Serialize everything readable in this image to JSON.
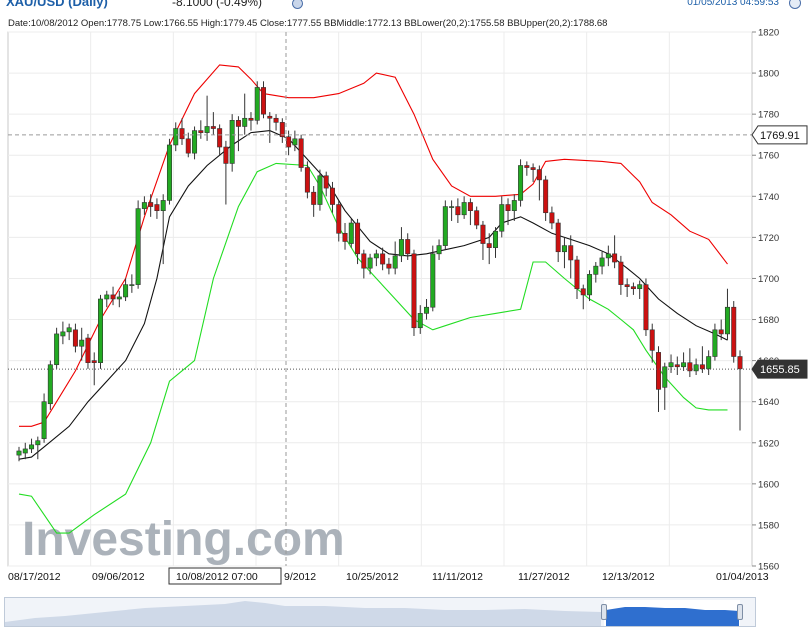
{
  "header": {
    "symbol": "XAU/USD (Daily)",
    "change": "-8.1000 (-0.49%)",
    "timestamp": "01/05/2013 04:59:53"
  },
  "info_bar": "Date:10/08/2012 Open:1778.75 Low:1766.55 High:1779.45 Close:1777.55 BBMiddle:1772.13 BBLower(20,2):1755.58 BBUpper(20,2):1788.68",
  "watermark": "Investing.com",
  "crosshair": {
    "date_label": "10/08/2012 07:00",
    "price_label": "1769.91"
  },
  "last_price_label": "1655.85",
  "colors": {
    "up": "#22aa22",
    "down": "#cc1111",
    "bb_upper": "#ee0000",
    "bb_lower": "#22dd22",
    "bb_middle": "#111111"
  },
  "chart_data": {
    "type": "candlestick",
    "xlabels": [
      "08/17/2012",
      "09/06/2012",
      "10/08/2012 07:00",
      "9/2012",
      "10/25/2012",
      "11/11/2012",
      "11/27/2012",
      "12/13/2012",
      "01/04/2013"
    ],
    "ylim": [
      1560,
      1820
    ],
    "yticks": [
      1560,
      1580,
      1600,
      1620,
      1640,
      1660,
      1680,
      1700,
      1720,
      1740,
      1760,
      1780,
      1800,
      1820
    ],
    "candles": [
      {
        "open": 1614,
        "close": 1616,
        "high": 1618,
        "low": 1611
      },
      {
        "open": 1615,
        "close": 1617,
        "high": 1620,
        "low": 1612
      },
      {
        "open": 1617,
        "close": 1619,
        "high": 1622,
        "low": 1615
      },
      {
        "open": 1619,
        "close": 1621,
        "high": 1623,
        "low": 1612
      },
      {
        "open": 1622,
        "close": 1640,
        "high": 1644,
        "low": 1620
      },
      {
        "open": 1639,
        "close": 1658,
        "high": 1660,
        "low": 1636
      },
      {
        "open": 1658,
        "close": 1673,
        "high": 1676,
        "low": 1656
      },
      {
        "open": 1672,
        "close": 1674,
        "high": 1679,
        "low": 1668
      },
      {
        "open": 1674,
        "close": 1676,
        "high": 1678,
        "low": 1670
      },
      {
        "open": 1675,
        "close": 1667,
        "high": 1678,
        "low": 1664
      },
      {
        "open": 1667,
        "close": 1670,
        "high": 1676,
        "low": 1660
      },
      {
        "open": 1671,
        "close": 1659,
        "high": 1673,
        "low": 1656
      },
      {
        "open": 1660,
        "close": 1659,
        "high": 1664,
        "low": 1648
      },
      {
        "open": 1659,
        "close": 1690,
        "high": 1692,
        "low": 1656
      },
      {
        "open": 1690,
        "close": 1692,
        "high": 1694,
        "low": 1686
      },
      {
        "open": 1692,
        "close": 1690,
        "high": 1696,
        "low": 1687
      },
      {
        "open": 1690,
        "close": 1691,
        "high": 1694,
        "low": 1686
      },
      {
        "open": 1691,
        "close": 1697,
        "high": 1700,
        "low": 1689
      },
      {
        "open": 1697,
        "close": 1697,
        "high": 1702,
        "low": 1693
      },
      {
        "open": 1697,
        "close": 1734,
        "high": 1738,
        "low": 1695
      },
      {
        "open": 1734,
        "close": 1737,
        "high": 1740,
        "low": 1731
      },
      {
        "open": 1737,
        "close": 1735,
        "high": 1741,
        "low": 1730
      },
      {
        "open": 1736,
        "close": 1733,
        "high": 1739,
        "low": 1729
      },
      {
        "open": 1733,
        "close": 1738,
        "high": 1741,
        "low": 1707
      },
      {
        "open": 1738,
        "close": 1765,
        "high": 1768,
        "low": 1736
      },
      {
        "open": 1765,
        "close": 1773,
        "high": 1776,
        "low": 1762
      },
      {
        "open": 1773,
        "close": 1768,
        "high": 1778,
        "low": 1765
      },
      {
        "open": 1768,
        "close": 1761,
        "high": 1771,
        "low": 1759
      },
      {
        "open": 1761,
        "close": 1772,
        "high": 1774,
        "low": 1758
      },
      {
        "open": 1772,
        "close": 1771,
        "high": 1777,
        "low": 1768
      },
      {
        "open": 1771,
        "close": 1774,
        "high": 1789,
        "low": 1767
      },
      {
        "open": 1774,
        "close": 1773,
        "high": 1781,
        "low": 1770
      },
      {
        "open": 1773,
        "close": 1764,
        "high": 1775,
        "low": 1760
      },
      {
        "open": 1764,
        "close": 1756,
        "high": 1767,
        "low": 1736
      },
      {
        "open": 1756,
        "close": 1777,
        "high": 1780,
        "low": 1752
      },
      {
        "open": 1777,
        "close": 1774,
        "high": 1779,
        "low": 1762
      },
      {
        "open": 1774,
        "close": 1778,
        "high": 1790,
        "low": 1770
      },
      {
        "open": 1778,
        "close": 1777,
        "high": 1781,
        "low": 1772
      },
      {
        "open": 1777,
        "close": 1793,
        "high": 1796,
        "low": 1775
      },
      {
        "open": 1793,
        "close": 1780,
        "high": 1796,
        "low": 1778
      },
      {
        "open": 1779,
        "close": 1778,
        "high": 1781,
        "low": 1766
      },
      {
        "open": 1778,
        "close": 1776,
        "high": 1780,
        "low": 1772
      },
      {
        "open": 1776,
        "close": 1769,
        "high": 1778,
        "low": 1766
      },
      {
        "open": 1769,
        "close": 1764,
        "high": 1772,
        "low": 1760
      },
      {
        "open": 1765,
        "close": 1768,
        "high": 1772,
        "low": 1762
      },
      {
        "open": 1768,
        "close": 1754,
        "high": 1770,
        "low": 1752
      },
      {
        "open": 1754,
        "close": 1742,
        "high": 1757,
        "low": 1739
      },
      {
        "open": 1742,
        "close": 1736,
        "high": 1745,
        "low": 1730
      },
      {
        "open": 1736,
        "close": 1750,
        "high": 1753,
        "low": 1733
      },
      {
        "open": 1750,
        "close": 1744,
        "high": 1752,
        "low": 1740
      },
      {
        "open": 1744,
        "close": 1736,
        "high": 1747,
        "low": 1732
      },
      {
        "open": 1736,
        "close": 1722,
        "high": 1738,
        "low": 1718
      },
      {
        "open": 1722,
        "close": 1718,
        "high": 1727,
        "low": 1714
      },
      {
        "open": 1717,
        "close": 1727,
        "high": 1729,
        "low": 1715
      },
      {
        "open": 1727,
        "close": 1712,
        "high": 1729,
        "low": 1707
      },
      {
        "open": 1712,
        "close": 1705,
        "high": 1714,
        "low": 1700
      },
      {
        "open": 1705,
        "close": 1710,
        "high": 1712,
        "low": 1702
      },
      {
        "open": 1710,
        "close": 1712,
        "high": 1714,
        "low": 1706
      },
      {
        "open": 1712,
        "close": 1707,
        "high": 1715,
        "low": 1704
      },
      {
        "open": 1707,
        "close": 1705,
        "high": 1710,
        "low": 1702
      },
      {
        "open": 1705,
        "close": 1711,
        "high": 1718,
        "low": 1702
      },
      {
        "open": 1711,
        "close": 1719,
        "high": 1725,
        "low": 1708
      },
      {
        "open": 1719,
        "close": 1712,
        "high": 1722,
        "low": 1709
      },
      {
        "open": 1712,
        "close": 1676,
        "high": 1714,
        "low": 1672
      },
      {
        "open": 1676,
        "close": 1683,
        "high": 1687,
        "low": 1673
      },
      {
        "open": 1683,
        "close": 1686,
        "high": 1690,
        "low": 1680
      },
      {
        "open": 1686,
        "close": 1712,
        "high": 1716,
        "low": 1684
      },
      {
        "open": 1712,
        "close": 1716,
        "high": 1719,
        "low": 1709
      },
      {
        "open": 1716,
        "close": 1735,
        "high": 1738,
        "low": 1714
      },
      {
        "open": 1735,
        "close": 1735,
        "high": 1738,
        "low": 1728
      },
      {
        "open": 1735,
        "close": 1731,
        "high": 1739,
        "low": 1727
      },
      {
        "open": 1731,
        "close": 1737,
        "high": 1740,
        "low": 1729
      },
      {
        "open": 1737,
        "close": 1733,
        "high": 1739,
        "low": 1726
      },
      {
        "open": 1733,
        "close": 1726,
        "high": 1735,
        "low": 1724
      },
      {
        "open": 1726,
        "close": 1717,
        "high": 1728,
        "low": 1709
      },
      {
        "open": 1717,
        "close": 1715,
        "high": 1722,
        "low": 1707
      },
      {
        "open": 1715,
        "close": 1723,
        "high": 1725,
        "low": 1710
      },
      {
        "open": 1723,
        "close": 1736,
        "high": 1740,
        "low": 1720
      },
      {
        "open": 1736,
        "close": 1733,
        "high": 1739,
        "low": 1726
      },
      {
        "open": 1733,
        "close": 1738,
        "high": 1741,
        "low": 1728
      },
      {
        "open": 1738,
        "close": 1755,
        "high": 1758,
        "low": 1735
      },
      {
        "open": 1755,
        "close": 1754,
        "high": 1757,
        "low": 1750
      },
      {
        "open": 1754,
        "close": 1753,
        "high": 1756,
        "low": 1747
      },
      {
        "open": 1753,
        "close": 1748,
        "high": 1755,
        "low": 1738
      },
      {
        "open": 1748,
        "close": 1732,
        "high": 1750,
        "low": 1728
      },
      {
        "open": 1732,
        "close": 1727,
        "high": 1735,
        "low": 1724
      },
      {
        "open": 1727,
        "close": 1713,
        "high": 1729,
        "low": 1708
      },
      {
        "open": 1713,
        "close": 1716,
        "high": 1720,
        "low": 1705
      },
      {
        "open": 1716,
        "close": 1709,
        "high": 1721,
        "low": 1700
      },
      {
        "open": 1709,
        "close": 1695,
        "high": 1711,
        "low": 1690
      },
      {
        "open": 1695,
        "close": 1692,
        "high": 1697,
        "low": 1685
      },
      {
        "open": 1692,
        "close": 1702,
        "high": 1704,
        "low": 1689
      },
      {
        "open": 1702,
        "close": 1706,
        "high": 1708,
        "low": 1698
      },
      {
        "open": 1706,
        "close": 1710,
        "high": 1713,
        "low": 1702
      },
      {
        "open": 1710,
        "close": 1712,
        "high": 1716,
        "low": 1706
      },
      {
        "open": 1712,
        "close": 1708,
        "high": 1721,
        "low": 1705
      },
      {
        "open": 1708,
        "close": 1697,
        "high": 1711,
        "low": 1692
      },
      {
        "open": 1697,
        "close": 1696,
        "high": 1700,
        "low": 1691
      },
      {
        "open": 1696,
        "close": 1695,
        "high": 1698,
        "low": 1692
      },
      {
        "open": 1695,
        "close": 1697,
        "high": 1699,
        "low": 1690
      },
      {
        "open": 1697,
        "close": 1675,
        "high": 1700,
        "low": 1672
      },
      {
        "open": 1675,
        "close": 1665,
        "high": 1678,
        "low": 1659
      },
      {
        "open": 1664,
        "close": 1646,
        "high": 1667,
        "low": 1635
      },
      {
        "open": 1647,
        "close": 1657,
        "high": 1659,
        "low": 1636
      },
      {
        "open": 1657,
        "close": 1659,
        "high": 1663,
        "low": 1654
      },
      {
        "open": 1658,
        "close": 1657,
        "high": 1662,
        "low": 1653
      },
      {
        "open": 1657,
        "close": 1659,
        "high": 1664,
        "low": 1655
      },
      {
        "open": 1659,
        "close": 1655,
        "high": 1666,
        "low": 1652
      },
      {
        "open": 1655,
        "close": 1658,
        "high": 1661,
        "low": 1653
      },
      {
        "open": 1658,
        "close": 1656,
        "high": 1667,
        "low": 1654
      },
      {
        "open": 1656,
        "close": 1662,
        "high": 1665,
        "low": 1653
      },
      {
        "open": 1662,
        "close": 1675,
        "high": 1678,
        "low": 1660
      },
      {
        "open": 1675,
        "close": 1673,
        "high": 1680,
        "low": 1670
      },
      {
        "open": 1673,
        "close": 1686,
        "high": 1695,
        "low": 1670
      },
      {
        "open": 1686,
        "close": 1662,
        "high": 1689,
        "low": 1659
      },
      {
        "open": 1662,
        "close": 1656,
        "high": 1665,
        "low": 1626
      }
    ],
    "bb_upper": [
      [
        1628,
        0
      ],
      [
        1628,
        2
      ],
      [
        1630,
        4
      ],
      [
        1640,
        6
      ],
      [
        1655,
        9
      ],
      [
        1680,
        13
      ],
      [
        1700,
        17
      ],
      [
        1730,
        20
      ],
      [
        1765,
        24
      ],
      [
        1790,
        28
      ],
      [
        1804,
        32
      ],
      [
        1803,
        35
      ],
      [
        1797,
        37
      ],
      [
        1790,
        39
      ],
      [
        1788,
        43
      ],
      [
        1788,
        47
      ],
      [
        1790,
        51
      ],
      [
        1795,
        55
      ],
      [
        1800,
        57
      ],
      [
        1798,
        60
      ],
      [
        1780,
        63
      ],
      [
        1758,
        66
      ],
      [
        1745,
        69
      ],
      [
        1740,
        72
      ],
      [
        1740,
        76
      ],
      [
        1741,
        80
      ],
      [
        1746,
        82
      ],
      [
        1757,
        84
      ],
      [
        1758,
        87
      ],
      [
        1757,
        93
      ],
      [
        1756,
        96
      ],
      [
        1747,
        99
      ],
      [
        1737,
        101
      ],
      [
        1731,
        104
      ],
      [
        1723,
        107
      ],
      [
        1719,
        110
      ],
      [
        1707,
        113
      ]
    ],
    "bb_lower": [
      [
        1595,
        0
      ],
      [
        1594,
        2
      ],
      [
        1585,
        4
      ],
      [
        1576,
        6
      ],
      [
        1576,
        8
      ],
      [
        1585,
        12
      ],
      [
        1595,
        17
      ],
      [
        1620,
        21
      ],
      [
        1650,
        24
      ],
      [
        1660,
        28
      ],
      [
        1700,
        31
      ],
      [
        1735,
        35
      ],
      [
        1752,
        38
      ],
      [
        1756,
        41
      ],
      [
        1755,
        46
      ],
      [
        1745,
        48
      ],
      [
        1725,
        51
      ],
      [
        1710,
        54
      ],
      [
        1700,
        57
      ],
      [
        1690,
        60
      ],
      [
        1680,
        63
      ],
      [
        1675,
        66
      ],
      [
        1677,
        68
      ],
      [
        1681,
        72
      ],
      [
        1683,
        76
      ],
      [
        1685,
        80
      ],
      [
        1708,
        82
      ],
      [
        1708,
        84
      ],
      [
        1700,
        87
      ],
      [
        1690,
        91
      ],
      [
        1685,
        94
      ],
      [
        1680,
        96
      ],
      [
        1675,
        98
      ],
      [
        1665,
        100
      ],
      [
        1652,
        103
      ],
      [
        1642,
        106
      ],
      [
        1637,
        108
      ],
      [
        1636,
        110
      ],
      [
        1636,
        113
      ]
    ],
    "bb_middle": [
      [
        1612,
        0
      ],
      [
        1613,
        2
      ],
      [
        1618,
        4
      ],
      [
        1628,
        8
      ],
      [
        1640,
        11
      ],
      [
        1650,
        14
      ],
      [
        1660,
        17
      ],
      [
        1678,
        20
      ],
      [
        1700,
        22
      ],
      [
        1730,
        24
      ],
      [
        1745,
        27
      ],
      [
        1755,
        30
      ],
      [
        1765,
        34
      ],
      [
        1771,
        37
      ],
      [
        1772,
        40
      ],
      [
        1768,
        43
      ],
      [
        1758,
        46
      ],
      [
        1748,
        49
      ],
      [
        1733,
        52
      ],
      [
        1718,
        56
      ],
      [
        1712,
        59
      ],
      [
        1711,
        62
      ],
      [
        1712,
        65
      ],
      [
        1714,
        68
      ],
      [
        1716,
        71
      ],
      [
        1720,
        75
      ],
      [
        1727,
        77
      ],
      [
        1730,
        80
      ],
      [
        1727,
        82
      ],
      [
        1722,
        85
      ],
      [
        1719,
        88
      ],
      [
        1716,
        91
      ],
      [
        1712,
        94
      ],
      [
        1705,
        97
      ],
      [
        1700,
        99
      ],
      [
        1690,
        102
      ],
      [
        1683,
        105
      ],
      [
        1677,
        108
      ],
      [
        1673,
        111
      ],
      [
        1670,
        113
      ]
    ]
  }
}
